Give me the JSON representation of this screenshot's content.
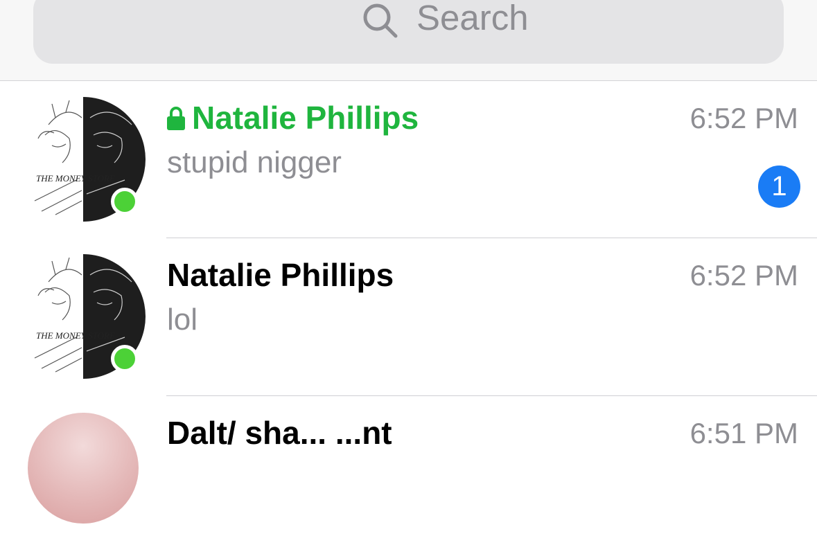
{
  "search": {
    "placeholder": "Search",
    "icon": "search-icon"
  },
  "conversations": [
    {
      "name": "Natalie Phillips",
      "secret": true,
      "lock_icon": "lock-icon",
      "preview": "stupid nigger",
      "time": "6:52 PM",
      "unread": "1",
      "online": true,
      "avatar_text": "THE MONEY STORE"
    },
    {
      "name": "Natalie Phillips",
      "secret": false,
      "preview": "lol",
      "time": "6:52 PM",
      "online": true,
      "avatar_text": "THE MONEY STORE"
    },
    {
      "name": "Dalt/ sha... ...nt",
      "time": "6:51 PM"
    }
  ],
  "colors": {
    "secret_name": "#1fb53e",
    "badge": "#1a7cf5",
    "online": "#4cd137",
    "secondary_text": "#8e8e93"
  }
}
